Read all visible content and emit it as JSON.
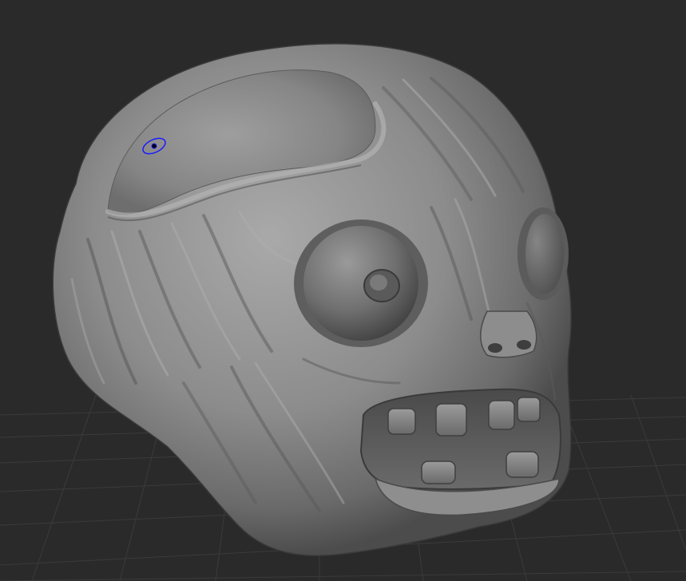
{
  "viewport": {
    "background_color": "#2a2a2a",
    "grid_color": "#3d3d3d",
    "model": {
      "name": "zombie-head-sculpt",
      "material_color": "#8a8a8a",
      "highlight_color": "#b4b4b4",
      "shadow_color": "#4a4a4a"
    },
    "brush_cursor": {
      "icon": "brush-cursor-icon",
      "color": "#1a1aff"
    }
  }
}
